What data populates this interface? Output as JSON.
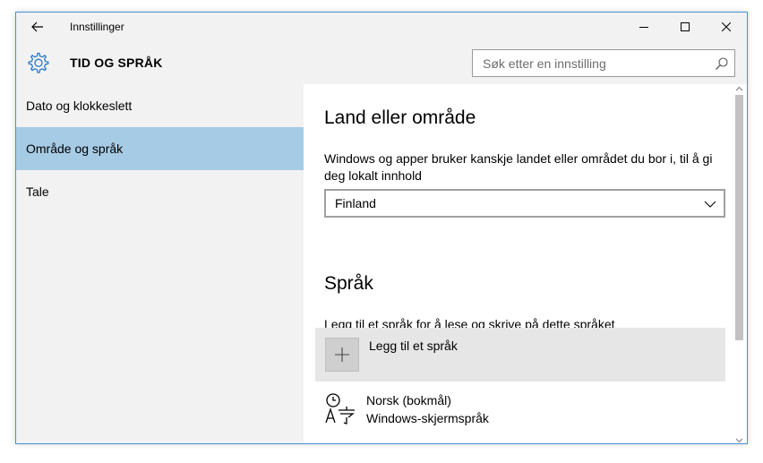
{
  "window": {
    "app_title": "Innstillinger"
  },
  "header": {
    "section_title": "TID OG SPRÅK",
    "search_placeholder": "Søk etter en innstilling"
  },
  "sidebar": {
    "items": [
      {
        "label": "Dato og klokkeslett",
        "selected": false
      },
      {
        "label": "Område og språk",
        "selected": true
      },
      {
        "label": "Tale",
        "selected": false
      }
    ]
  },
  "content": {
    "region": {
      "heading": "Land eller område",
      "description": "Windows og apper bruker kanskje landet eller området du bor i, til å gi deg lokalt innhold",
      "selected_value": "Finland"
    },
    "language": {
      "heading": "Språk",
      "description": "Legg til et språk for å lese og skrive på dette språket",
      "add_label": "Legg til et språk",
      "installed": [
        {
          "name": "Norsk (bokmål)",
          "status": "Windows-skjermspråk"
        }
      ]
    }
  },
  "colors": {
    "accent": "#2a77c9",
    "selection": "#a6cbe4",
    "chrome": "#f2f2f2",
    "window_border": "#4a90d6"
  },
  "icons": [
    "back-arrow-icon",
    "minimize-icon",
    "maximize-icon",
    "close-icon",
    "gear-icon",
    "search-icon",
    "chevron-down-icon",
    "plus-icon",
    "language-icon"
  ]
}
